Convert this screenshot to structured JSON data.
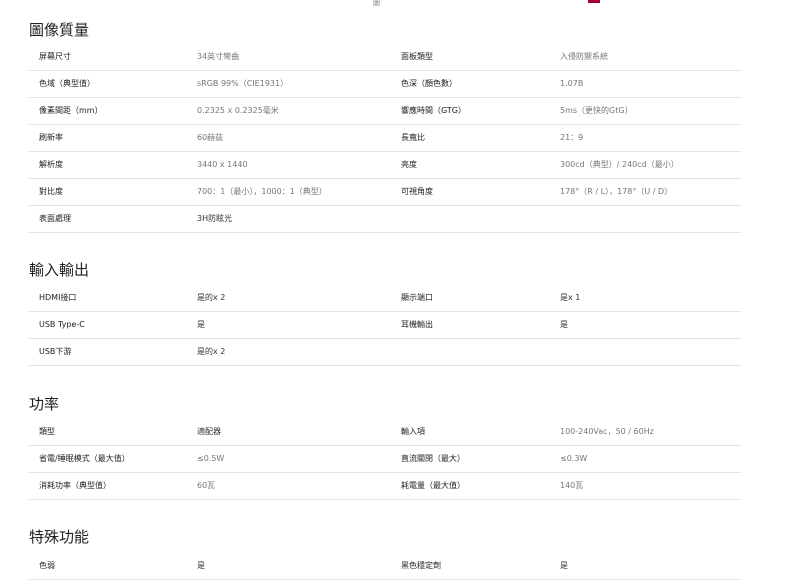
{
  "top_glyph": "圖",
  "sections": [
    {
      "title": "圖像質量",
      "rows": [
        [
          "屏幕尺寸",
          "34英寸彎曲",
          "面板類型",
          "入侵防禦系統"
        ],
        [
          "色域（典型值）",
          "sRGB 99%（CIE1931）",
          "色深（顏色數）",
          "1.07B"
        ],
        [
          "像素間距（mm）",
          "0.2325 x 0.2325毫米",
          "響應時間（GTG）",
          "5ms（更快的GtG）"
        ],
        [
          "刷新率",
          "60赫茲",
          "長寬比",
          "21：9"
        ],
        [
          "解析度",
          "3440 x 1440",
          "亮度",
          "300cd（典型）/ 240cd（最小）"
        ],
        [
          "對比度",
          "700：1（最小），1000：1（典型）",
          "可視角度",
          "178°（R / L），178°（U / D）"
        ],
        [
          "表面處理",
          "3H防眩光",
          "",
          ""
        ]
      ]
    },
    {
      "title": "輸入輸出",
      "rows": [
        [
          "HDMI接口",
          "是的x 2",
          "顯示端口",
          "是x 1"
        ],
        [
          "USB Type-C",
          "是",
          "耳機輸出",
          "是"
        ],
        [
          "USB下游",
          "是的x 2",
          "",
          ""
        ]
      ]
    },
    {
      "title": "功率",
      "rows": [
        [
          "類型",
          "適配器",
          "輸入項",
          "100-240Vac，50 / 60Hz"
        ],
        [
          "省電/睡眠模式（最大值）",
          "≤0.5W",
          "直流關閉（最大）",
          "≤0.3W"
        ],
        [
          "消耗功率（典型值）",
          "60瓦",
          "耗電量（最大值）",
          "140瓦"
        ]
      ]
    },
    {
      "title": "特殊功能",
      "rows": [
        [
          "色弱",
          "是",
          "黑色穩定劑",
          "是"
        ]
      ]
    }
  ]
}
